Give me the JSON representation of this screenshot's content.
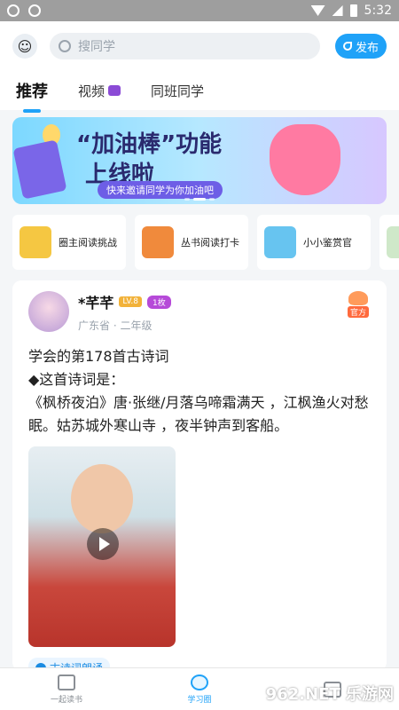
{
  "status_bar": {
    "time": "5:32"
  },
  "header": {
    "search_placeholder": "搜同学",
    "publish_label": "发布"
  },
  "tabs": [
    {
      "label": "推荐"
    },
    {
      "label": "视频"
    },
    {
      "label": "同班同学"
    }
  ],
  "banner": {
    "title_line1": "“加油棒”功能",
    "title_line2": "上线啦",
    "subtitle": "快来邀请同学为你加油吧"
  },
  "shortcuts": [
    {
      "label": "圈主阅读挑战",
      "color": "#f5c742"
    },
    {
      "label": "丛书阅读打卡",
      "color": "#f08a3c"
    },
    {
      "label": "小小鉴赏官",
      "color": "#67c4f0"
    }
  ],
  "post": {
    "username": "*芊芊",
    "level": "LV.8",
    "medal": "1枚",
    "location": "广东省 · 二年级",
    "official_tag": "官方",
    "text_line1": "学会的第178首古诗词",
    "text_line2": "◆这首诗词是：",
    "text_line3": "《枫桥夜泊》唐·张继/月落乌啼霜满天 ，江枫渔火对愁眠。姑苏城外寒山寺 ，夜半钟声到客船。",
    "topic": "古诗词朗诵"
  },
  "bottom_nav": [
    {
      "label": "一起读书"
    },
    {
      "label": "学习圈"
    },
    {
      "label": ""
    }
  ],
  "watermark": "962.NET 乐游网"
}
